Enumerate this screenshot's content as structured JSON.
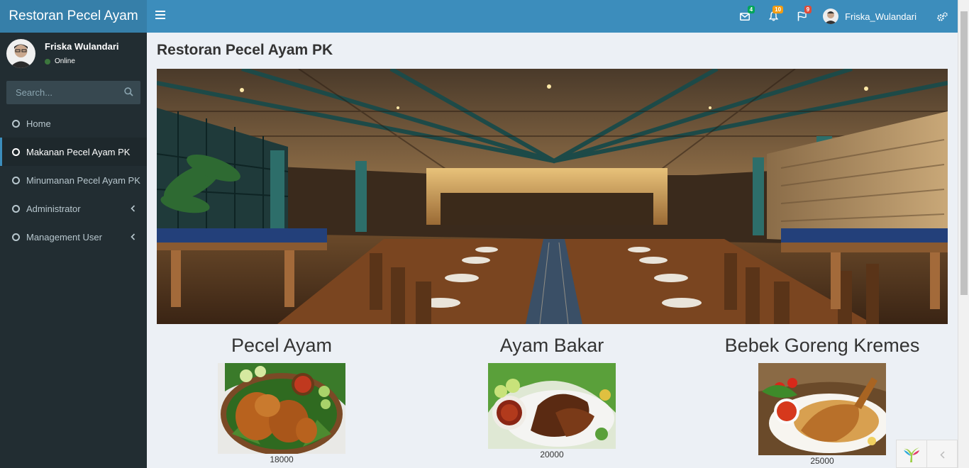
{
  "app": {
    "title": "Restoran Pecel Ayam"
  },
  "header": {
    "notifications": [
      {
        "icon": "envelope-icon",
        "count": "4",
        "color": "#00a65a"
      },
      {
        "icon": "bell-icon",
        "count": "10",
        "color": "#f39c12"
      },
      {
        "icon": "flag-icon",
        "count": "9",
        "color": "#dd4b39"
      }
    ],
    "user_name": "Friska_Wulandari"
  },
  "sidebar": {
    "user_name": "Friska Wulandari",
    "status": "Online",
    "search_placeholder": "Search...",
    "items": [
      {
        "label": "Home"
      },
      {
        "label": "Makanan Pecel Ayam PK",
        "active": true
      },
      {
        "label": "Minumanan Pecel Ayam PK"
      },
      {
        "label": "Administrator",
        "submenu": true
      },
      {
        "label": "Management User",
        "submenu": true
      }
    ]
  },
  "main": {
    "title": "Restoran Pecel Ayam PK",
    "dishes": [
      {
        "name": "Pecel Ayam",
        "price": "18000"
      },
      {
        "name": "Ayam Bakar",
        "price": "20000"
      },
      {
        "name": "Bebek Goreng Kremes",
        "price": "25000"
      }
    ]
  },
  "colors": {
    "header": "#3c8dbc",
    "logo": "#367fa9",
    "sidebar": "#222d32",
    "content": "#ecf0f5"
  }
}
